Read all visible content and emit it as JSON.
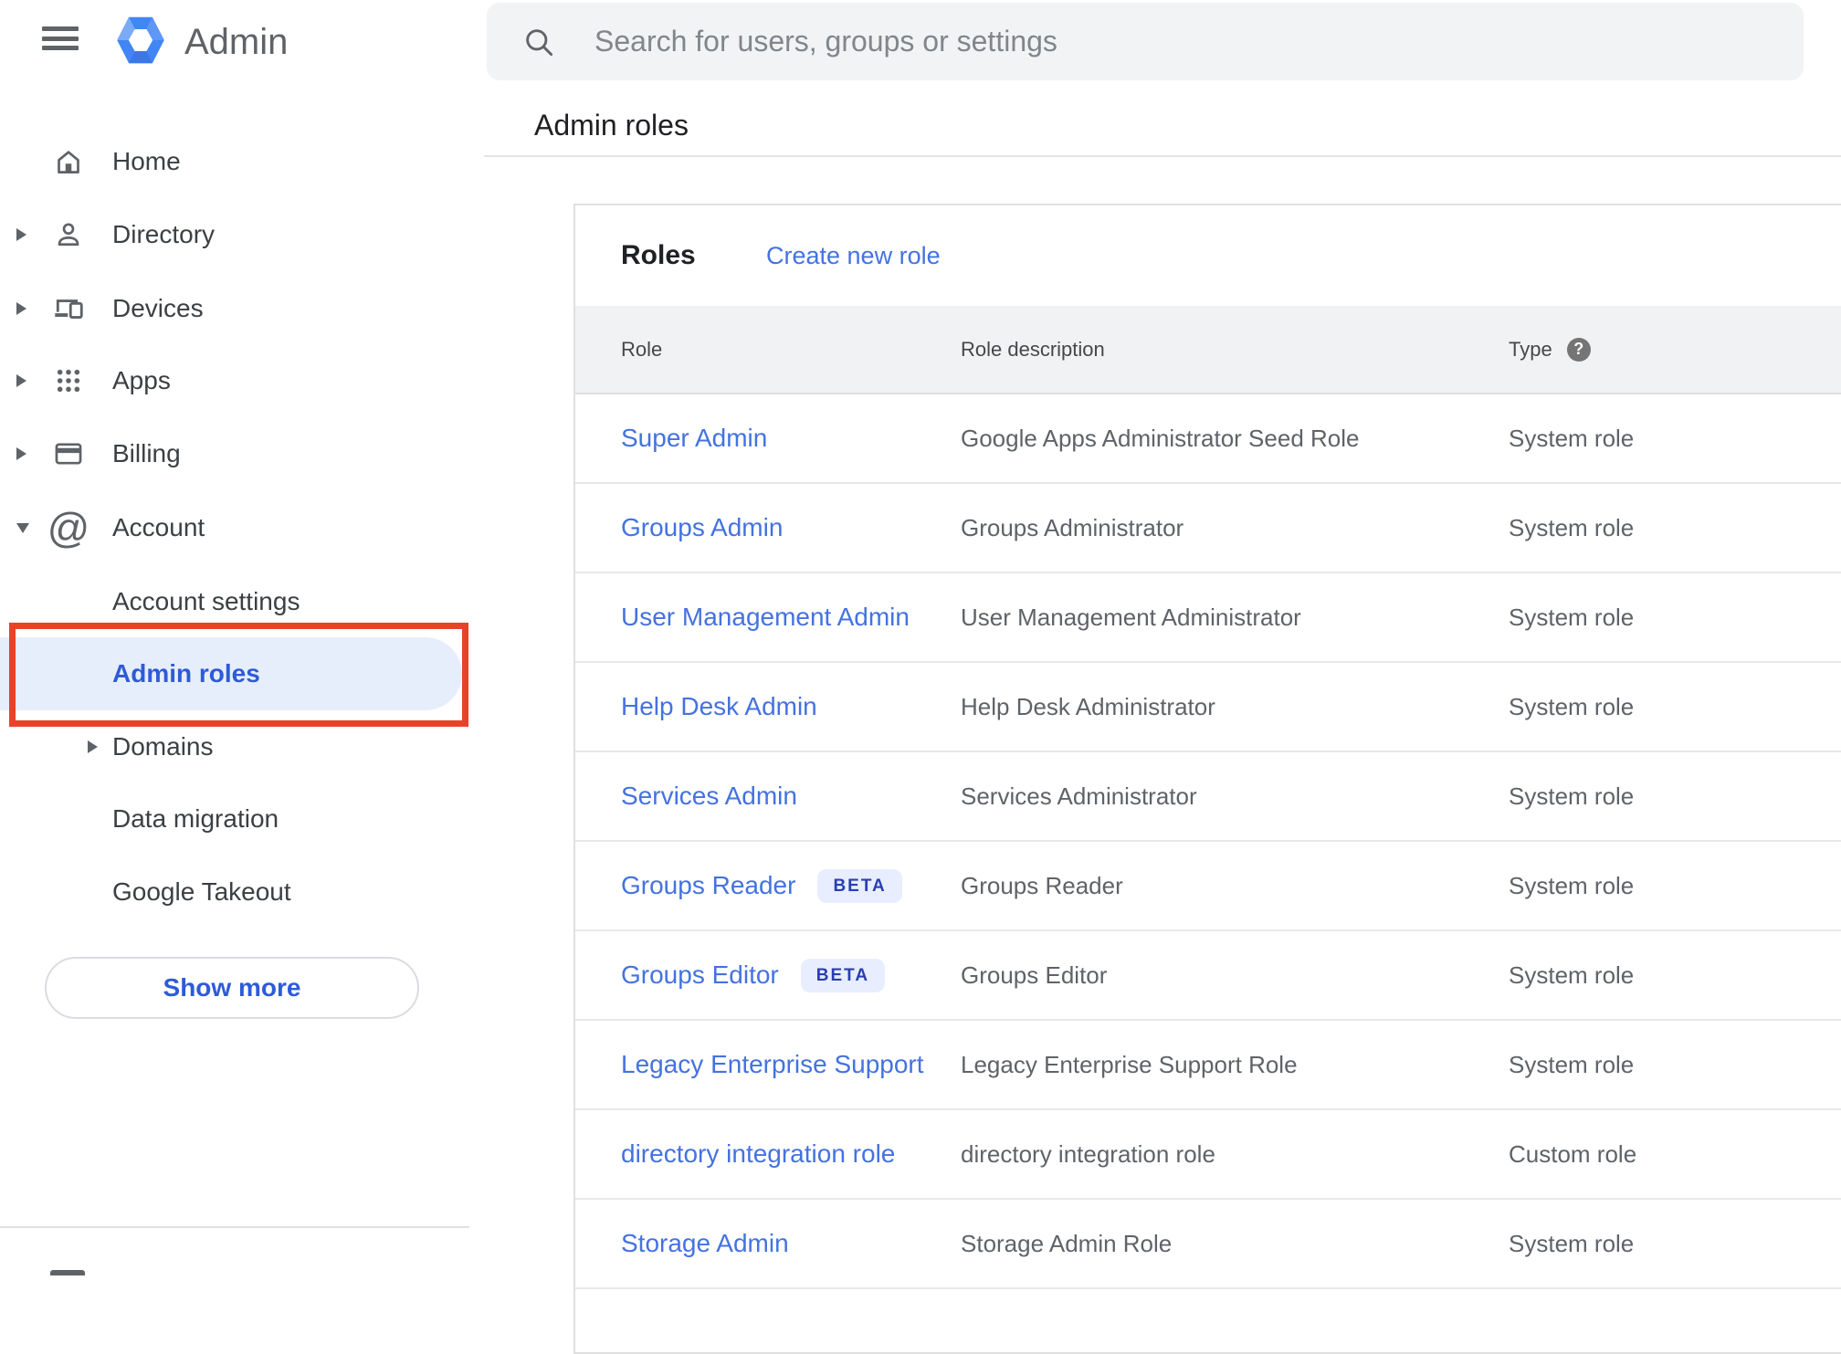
{
  "colors": {
    "accent_blue": "#2d5bd8",
    "link_blue": "#4472e0",
    "beta_text": "#2a3eb1",
    "beta_bg": "#e8eeff",
    "annotation_red": "#e8432a",
    "selected_item_bg": "#e7eefb"
  },
  "topbar": {
    "product_name": "Admin",
    "search_placeholder": "Search for users, groups or settings"
  },
  "breadcrumb": {
    "label": "Admin roles"
  },
  "sidebar": {
    "items": [
      {
        "label": "Home",
        "icon": "home",
        "level": 0,
        "arrow": "none"
      },
      {
        "label": "Directory",
        "icon": "person",
        "level": 0,
        "arrow": "right"
      },
      {
        "label": "Devices",
        "icon": "devices",
        "level": 0,
        "arrow": "right"
      },
      {
        "label": "Apps",
        "icon": "apps",
        "level": 0,
        "arrow": "right"
      },
      {
        "label": "Billing",
        "icon": "card",
        "level": 0,
        "arrow": "right"
      },
      {
        "label": "Account",
        "icon": "at",
        "level": 0,
        "arrow": "down"
      },
      {
        "label": "Account settings",
        "icon": "",
        "level": 1,
        "arrow": "none"
      },
      {
        "label": "Admin roles",
        "icon": "",
        "level": 1,
        "arrow": "none",
        "selected": true
      },
      {
        "label": "Domains",
        "icon": "",
        "level": 1,
        "arrow": "right"
      },
      {
        "label": "Data migration",
        "icon": "",
        "level": 1,
        "arrow": "none"
      },
      {
        "label": "Google Takeout",
        "icon": "",
        "level": 1,
        "arrow": "none"
      }
    ],
    "show_more_label": "Show more"
  },
  "content": {
    "card_title": "Roles",
    "create_link_label": "Create new role",
    "table": {
      "columns": [
        "Role",
        "Role description",
        "Type"
      ],
      "help_icon_glyph": "?",
      "beta_label": "BETA",
      "rows": [
        {
          "role": "Super Admin",
          "beta": false,
          "description": "Google Apps Administrator Seed Role",
          "type": "System role"
        },
        {
          "role": "Groups Admin",
          "beta": false,
          "description": "Groups Administrator",
          "type": "System role"
        },
        {
          "role": "User Management Admin",
          "beta": false,
          "description": "User Management Administrator",
          "type": "System role"
        },
        {
          "role": "Help Desk Admin",
          "beta": false,
          "description": "Help Desk Administrator",
          "type": "System role"
        },
        {
          "role": "Services Admin",
          "beta": false,
          "description": "Services Administrator",
          "type": "System role"
        },
        {
          "role": "Groups Reader",
          "beta": true,
          "description": "Groups Reader",
          "type": "System role"
        },
        {
          "role": "Groups Editor",
          "beta": true,
          "description": "Groups Editor",
          "type": "System role"
        },
        {
          "role": "Legacy Enterprise Support",
          "beta": false,
          "description": "Legacy Enterprise Support Role",
          "type": "System role"
        },
        {
          "role": "directory integration role",
          "beta": false,
          "description": "directory integration role",
          "type": "Custom role"
        },
        {
          "role": "Storage Admin",
          "beta": false,
          "description": "Storage Admin Role",
          "type": "System role"
        }
      ]
    }
  }
}
